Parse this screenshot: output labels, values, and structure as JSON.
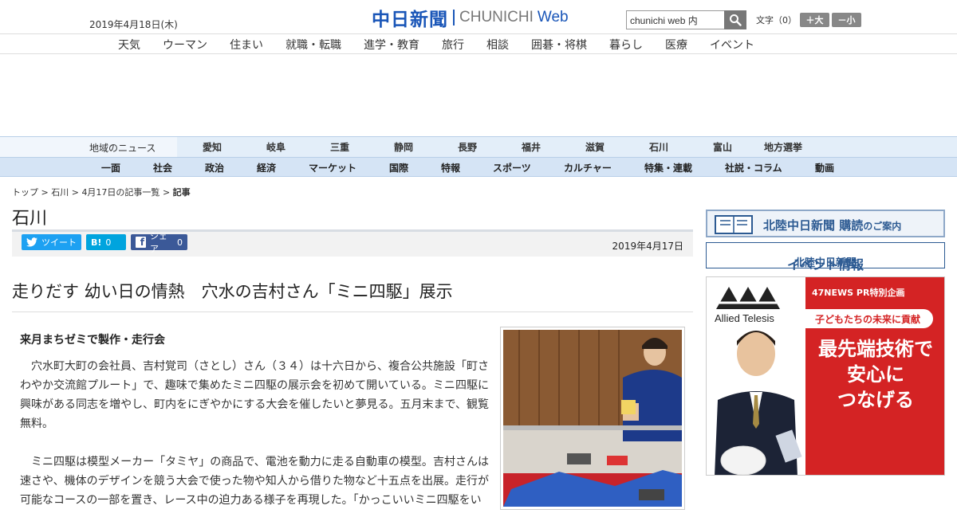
{
  "header": {
    "date": "2019年4月18日(木)",
    "logo_jp": "中日新聞",
    "logo_en": "CHUNICHI",
    "logo_web": "Web",
    "search_value": "chunichi web 内",
    "fontsize_label": "文字（0）",
    "font_larger": "＋大",
    "font_smaller": "－小"
  },
  "nav_top": [
    "天気",
    "ウーマン",
    "住まい",
    "就職・転職",
    "進学・教育",
    "旅行",
    "相談",
    "囲碁・将棋",
    "暮らし",
    "医療",
    "イベント"
  ],
  "nav_region": {
    "label": "地域のニュース",
    "items": [
      "愛知",
      "岐阜",
      "三重",
      "静岡",
      "長野",
      "福井",
      "滋賀",
      "石川",
      "富山",
      "地方選挙"
    ]
  },
  "nav_sections": [
    "一面",
    "社会",
    "政治",
    "経済",
    "マーケット",
    "国際",
    "特報",
    "スポーツ",
    "カルチャー",
    "特集・連載",
    "社説・コラム",
    "動画"
  ],
  "breadcrumb": {
    "top": "トップ",
    "region": "石川",
    "list": "4月17日の記事一覧",
    "current": "記事",
    "sep": ">"
  },
  "section_title": "石川",
  "share": {
    "tweet": "ツイート",
    "hatena_icon": "B!",
    "hatena_count": "0",
    "fb_label": "シェア",
    "fb_count": "0"
  },
  "article": {
    "pubdate": "2019年4月17日",
    "headline": "走りだす 幼い日の情熱　穴水の吉村さん「ミニ四駆」展示",
    "subhead": "来月まちゼミで製作・走行会",
    "paragraphs": [
      "穴水町大町の会社員、吉村覚司（さとし）さん（３４）は十六日から、複合公共施設「町さわやか交流館プルート」で、趣味で集めたミニ四駆の展示会を初めて開いている。ミニ四駆に興味がある同志を増やし、町内をにぎやかにする大会を催したいと夢見る。五月末まで、観覧無料。",
      "ミニ四駆は模型メーカー「タミヤ」の商品で、電池を動力に走る自動車の模型。吉村さんは速さや、機体のデザインを競う大会で使った物や知人から借りた物など十五点を出展。走行が可能なコースの一部を置き、レース中の迫力ある様子を再現した。「かっこいいミニ四駆をい"
    ]
  },
  "sidebar": {
    "banner1_main": "北陸中日新聞 購読",
    "banner1_small": "のご案内",
    "banner2_a": "北陸中日新聞",
    "banner2_b": "イベント情報",
    "ad_brand": "Allied Telesis",
    "ad_pr": "47NEWS PR特別企画",
    "ad_pill": "子どもたちの未来に貢献",
    "ad_big": [
      "最先端技術で",
      "安心に",
      "つなげる"
    ]
  },
  "colors": {
    "brand_blue": "#1a56b8",
    "twitter": "#1da1f2",
    "hatena": "#00a4de",
    "facebook": "#3b5998",
    "ad_red": "#d42324"
  }
}
